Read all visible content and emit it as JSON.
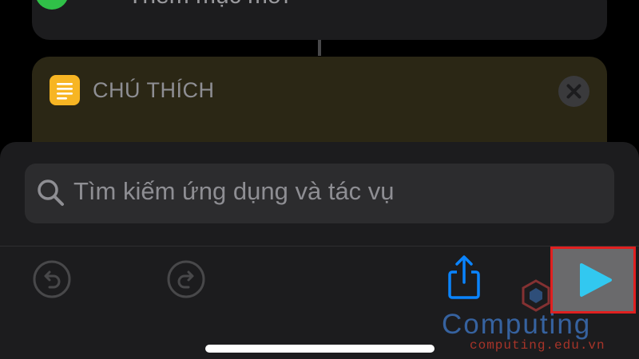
{
  "top_action": {
    "label": "Thêm mục mới"
  },
  "comment_card": {
    "title": "CHÚ THÍCH"
  },
  "search": {
    "placeholder": "Tìm kiếm ứng dụng và tác vụ"
  },
  "toolbar": {
    "undo_icon": "undo-icon",
    "redo_icon": "redo-icon",
    "share_icon": "share-icon",
    "play_icon": "play-icon"
  },
  "watermark": {
    "brand": "Computing",
    "url": "computing.edu.vn"
  },
  "colors": {
    "accent_blue": "#0a84ff",
    "play_cyan": "#32c8f0",
    "comment_yellow": "#f7b523",
    "highlight_red": "#e02020",
    "add_green": "#30c048"
  }
}
